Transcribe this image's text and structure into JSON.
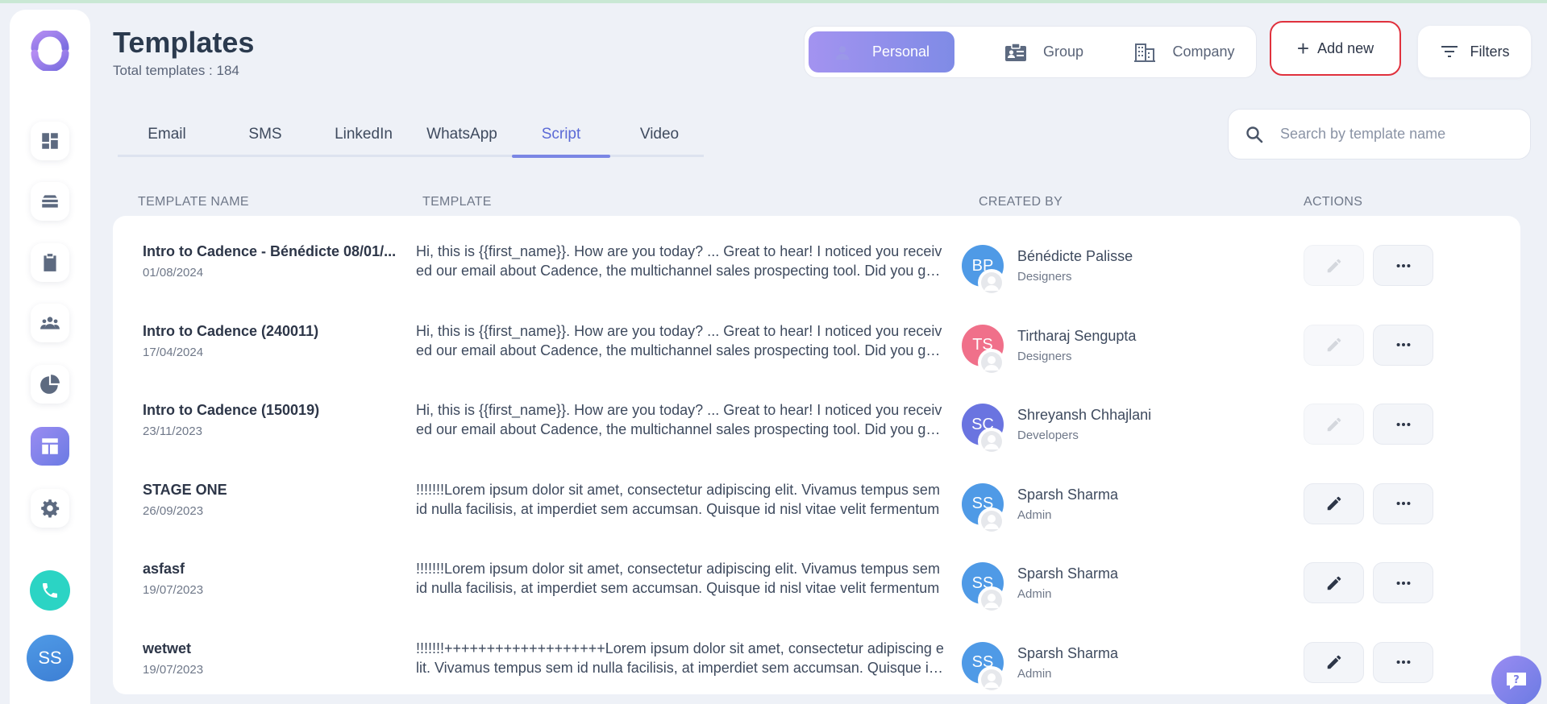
{
  "header": {
    "title": "Templates",
    "subtitle": "Total templates : 184"
  },
  "scope": {
    "personal": "Personal",
    "group": "Group",
    "company": "Company",
    "selected": "Personal"
  },
  "toolbar": {
    "add_new": "Add new",
    "filters": "Filters"
  },
  "tabs": [
    {
      "label": "Email"
    },
    {
      "label": "SMS"
    },
    {
      "label": "LinkedIn"
    },
    {
      "label": "WhatsApp"
    },
    {
      "label": "Script",
      "active": true
    },
    {
      "label": "Video"
    }
  ],
  "search": {
    "placeholder": "Search by template name",
    "value": ""
  },
  "table": {
    "columns": {
      "name": "TEMPLATE NAME",
      "template": "TEMPLATE",
      "created_by": "CREATED BY",
      "actions": "ACTIONS"
    },
    "rows": [
      {
        "name": "Intro to Cadence - Bénédicte 08/01/...",
        "date": "01/08/2024",
        "body": "Hi, this is {{first_name}}. How are you today? ... Great to hear! I noticed you received our email about Cadence, the multichannel sales prospecting tool. Did you get a chance to look at it?",
        "initials": "BP",
        "creator": "Bénédicte Palisse",
        "team": "Designers",
        "avatar_color": "#4f9ae6",
        "edit_enabled": false
      },
      {
        "name": "Intro to Cadence (240011)",
        "date": "17/04/2024",
        "body": "Hi, this is {{first_name}}. How are you today? ... Great to hear! I noticed you received our email about Cadence, the multichannel sales prospecting tool. Did you get a chance to look at it?",
        "initials": "TS",
        "creator": "Tirtharaj Sengupta",
        "team": "Designers",
        "avatar_color": "#f0708a",
        "edit_enabled": false
      },
      {
        "name": "Intro to Cadence (150019)",
        "date": "23/11/2023",
        "body": "Hi, this is {{first_name}}. How are you today? ... Great to hear! I noticed you received our email about Cadence, the multichannel sales prospecting tool. Did you get a chance to look at it?",
        "initials": "SC",
        "creator": "Shreyansh Chhajlani",
        "team": "Developers",
        "avatar_color": "#6a74e0",
        "edit_enabled": false
      },
      {
        "name": "STAGE ONE",
        "date": "26/09/2023",
        "body": "!!!!!!!Lorem ipsum dolor sit amet, consectetur adipiscing elit. Vivamus tempus sem id nulla facilisis, at imperdiet sem accumsan. Quisque id nisl vitae velit fermentum",
        "initials": "SS",
        "creator": "Sparsh Sharma",
        "team": "Admin",
        "avatar_color": "#4f9ae6",
        "edit_enabled": true
      },
      {
        "name": "asfasf",
        "date": "19/07/2023",
        "body": "!!!!!!!Lorem ipsum dolor sit amet, consectetur adipiscing elit. Vivamus tempus sem id nulla facilisis, at imperdiet sem accumsan. Quisque id nisl vitae velit fermentum",
        "initials": "SS",
        "creator": "Sparsh Sharma",
        "team": "Admin",
        "avatar_color": "#4f9ae6",
        "edit_enabled": true
      },
      {
        "name": "wetwet",
        "date": "19/07/2023",
        "body": "!!!!!!!+++++++++++++++++++Lorem ipsum dolor sit amet, consectetur adipiscing elit. Vivamus tempus sem id nulla facilisis, at imperdiet sem accumsan. Quisque id nisl",
        "initials": "SS",
        "creator": "Sparsh Sharma",
        "team": "Admin",
        "avatar_color": "#4f9ae6",
        "edit_enabled": true
      }
    ]
  },
  "user": {
    "initials": "SS"
  },
  "icons": {
    "logo": "cadence-logo-icon",
    "nav": [
      "dashboard-icon",
      "stack-icon",
      "clipboard-icon",
      "people-icon",
      "pie-chart-icon",
      "templates-icon",
      "gear-icon"
    ],
    "call": "phone-icon",
    "help": "help-chat-icon"
  },
  "colors": {
    "accent": "#7a86e4",
    "call": "#2bd4c4",
    "add_new_border": "#e0313d"
  }
}
